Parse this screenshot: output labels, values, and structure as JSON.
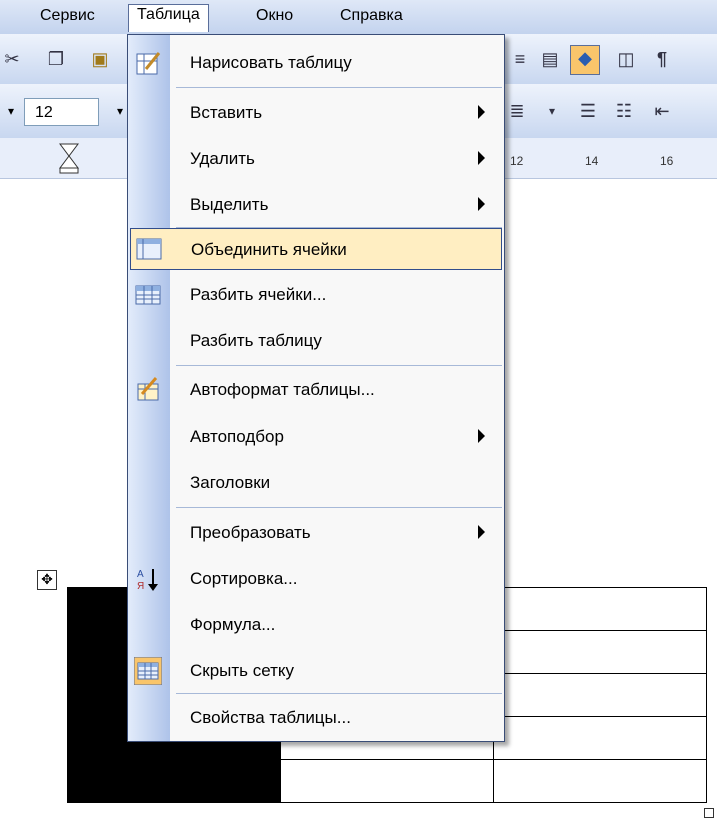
{
  "menubar": {
    "items": [
      "Сервис",
      "Таблица",
      "Окно",
      "Справка"
    ]
  },
  "toolbar": {
    "font_size": "12",
    "ruler_marks": [
      "12",
      "14",
      "16"
    ]
  },
  "menu": {
    "items": [
      {
        "label": "Нарисовать таблицу",
        "submenu": false,
        "icon": "draw-table-icon"
      },
      {
        "label": "Вставить",
        "submenu": true,
        "icon": ""
      },
      {
        "label": "Удалить",
        "submenu": true,
        "icon": ""
      },
      {
        "label": "Выделить",
        "submenu": true,
        "icon": ""
      },
      {
        "label": "Объединить ячейки",
        "submenu": false,
        "icon": "merge-cells-icon",
        "highlighted": true
      },
      {
        "label": "Разбить ячейки...",
        "submenu": false,
        "icon": "split-cells-icon"
      },
      {
        "label": "Разбить таблицу",
        "submenu": false,
        "icon": ""
      },
      {
        "label": "Автоформат таблицы...",
        "submenu": false,
        "icon": "autoformat-icon"
      },
      {
        "label": "Автоподбор",
        "submenu": true,
        "icon": ""
      },
      {
        "label": "Заголовки",
        "submenu": false,
        "icon": ""
      },
      {
        "label": "Преобразовать",
        "submenu": true,
        "icon": ""
      },
      {
        "label": "Сортировка...",
        "submenu": false,
        "icon": "sort-icon"
      },
      {
        "label": "Формула...",
        "submenu": false,
        "icon": ""
      },
      {
        "label": "Скрыть сетку",
        "submenu": false,
        "icon": "hide-grid-icon"
      },
      {
        "label": "Свойства таблицы...",
        "submenu": false,
        "icon": ""
      }
    ]
  },
  "colors": {
    "background": "#0a0a7e",
    "highlight": "#ffeec2",
    "highlight_border": "#314d8c"
  }
}
